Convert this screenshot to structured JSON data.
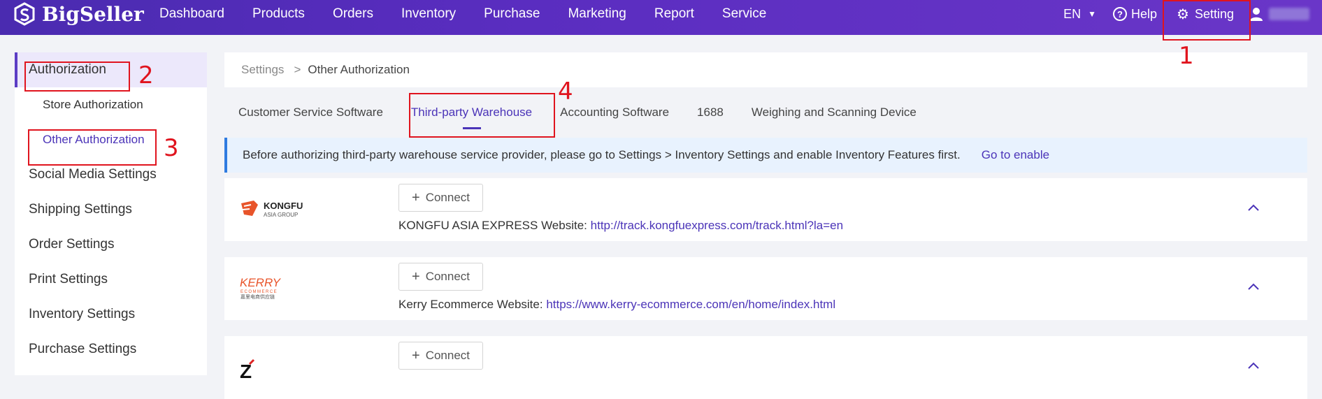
{
  "app": {
    "name": "BigSeller"
  },
  "nav": {
    "items": [
      "Dashboard",
      "Products",
      "Orders",
      "Inventory",
      "Purchase",
      "Marketing",
      "Report",
      "Service"
    ]
  },
  "topright": {
    "lang": "EN",
    "help": "Help",
    "setting": "Setting"
  },
  "sidebar": {
    "items": [
      {
        "label": "Authorization"
      },
      {
        "label": "Store Authorization"
      },
      {
        "label": "Other Authorization"
      },
      {
        "label": "Social Media Settings"
      },
      {
        "label": "Shipping Settings"
      },
      {
        "label": "Order Settings"
      },
      {
        "label": "Print Settings"
      },
      {
        "label": "Inventory Settings"
      },
      {
        "label": "Purchase Settings"
      }
    ]
  },
  "breadcrumb": {
    "root": "Settings",
    "sep": ">",
    "current": "Other Authorization"
  },
  "tabs": [
    "Customer Service Software",
    "Third-party Warehouse",
    "Accounting Software",
    "1688",
    "Weighing and Scanning Device"
  ],
  "notice": {
    "text": "Before authorizing third-party warehouse service provider, please go to Settings > Inventory Settings and enable Inventory Features first.",
    "link": "Go to enable"
  },
  "providers": [
    {
      "logo_text": "KONGFU",
      "logo_sub": "ASIA GROUP",
      "connect": "Connect",
      "website_label": "KONGFU ASIA EXPRESS Website:",
      "website_url": "http://track.kongfuexpress.com/track.html?la=en"
    },
    {
      "logo_text": "KERRY",
      "logo_sub": "ECOMMERCE",
      "logo_sub2": "嘉里电商供应链",
      "connect": "Connect",
      "website_label": "Kerry Ecommerce Website:",
      "website_url": "https://www.kerry-ecommerce.com/en/home/index.html"
    },
    {
      "logo_text": "Z",
      "connect": "Connect"
    }
  ],
  "annotations": [
    "1",
    "2",
    "3",
    "4"
  ],
  "colors": {
    "topbar": "#5a2dc0",
    "accent": "#4b34b8",
    "annotation": "#e0141e",
    "notice_bg": "#e8f2fe"
  }
}
